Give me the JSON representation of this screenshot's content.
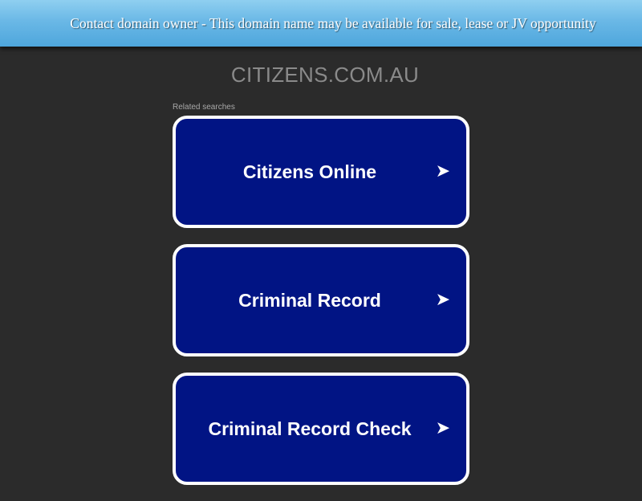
{
  "banner": {
    "text": "Contact domain owner - This domain name may be available for sale, lease or JV opportunity",
    "gradient_top": "#8fcff0",
    "gradient_bottom": "#4ea6dc"
  },
  "domain": {
    "title": "CITIZENS.COM.AU"
  },
  "related": {
    "label": "Related searches",
    "items": [
      {
        "label": "Citizens Online",
        "icon": "arrow-right-icon"
      },
      {
        "label": "Criminal Record",
        "icon": "arrow-right-icon"
      },
      {
        "label": "Criminal Record Check",
        "icon": "arrow-right-icon"
      }
    ]
  },
  "colors": {
    "background": "#2b2b2b",
    "result_fill": "#011484",
    "result_border": "#ffffff",
    "title_text": "#8a8a8a"
  }
}
